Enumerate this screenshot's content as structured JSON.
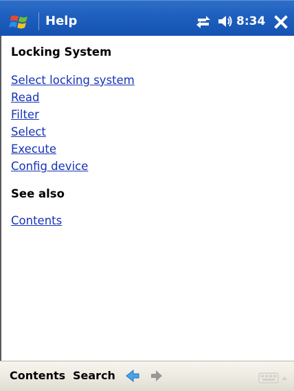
{
  "titlebar": {
    "title": "Help",
    "time": "8:34",
    "start_icon": "windows-flag-icon",
    "connectivity_icon": "connectivity-arrows-icon",
    "volume_icon": "speaker-icon",
    "close_icon": "close-icon",
    "bar_color": "#1e5fbe"
  },
  "content": {
    "heading": "Locking System",
    "links": [
      "Select locking system",
      "Read",
      "Filter",
      "Select",
      "Execute",
      "Config device"
    ],
    "see_also_heading": "See also",
    "see_also_links": [
      "Contents"
    ],
    "link_color": "#1533b8"
  },
  "menubar": {
    "contents_label": "Contents",
    "search_label": "Search",
    "back_icon": "back-arrow-icon",
    "forward_icon": "forward-arrow-icon",
    "keyboard_icon": "keyboard-icon"
  }
}
